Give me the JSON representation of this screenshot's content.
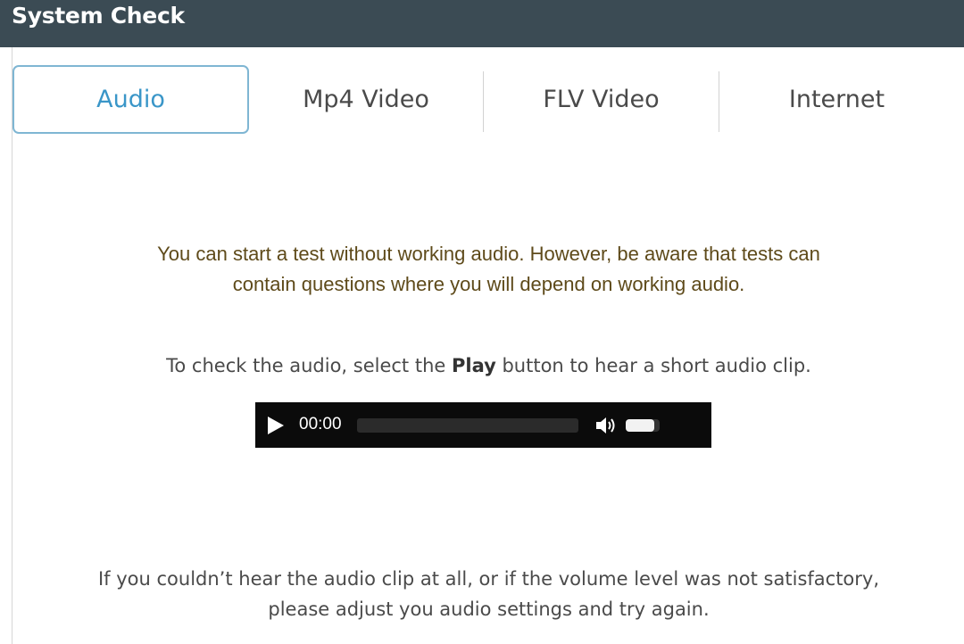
{
  "window": {
    "title": "System Check"
  },
  "tabs": [
    {
      "label": "Audio",
      "active": true
    },
    {
      "label": "Mp4 Video",
      "active": false
    },
    {
      "label": "FLV Video",
      "active": false
    },
    {
      "label": "Internet",
      "active": false
    }
  ],
  "audio": {
    "warning_line1": "You can start a test without working audio. However, be aware that tests can",
    "warning_line2": "contain questions where you will depend on working audio.",
    "instruction_before": "To check the audio, select the ",
    "instruction_bold": "Play",
    "instruction_after": " button to hear a short audio clip.",
    "note_line1": "If you couldn’t hear the audio clip at all, or if the volume level was not satisfactory,",
    "note_line2": "please adjust you audio settings and try again."
  },
  "player": {
    "time": "00:00",
    "play_icon": "play-icon",
    "volume_icon": "speaker-icon",
    "volume_level": 0.85,
    "progress": 0
  },
  "colors": {
    "titlebar": "#3b4b54",
    "active_tab": "#3a96c8",
    "active_tab_border": "#7fb6d3",
    "warning_text": "#5e4a1a"
  }
}
